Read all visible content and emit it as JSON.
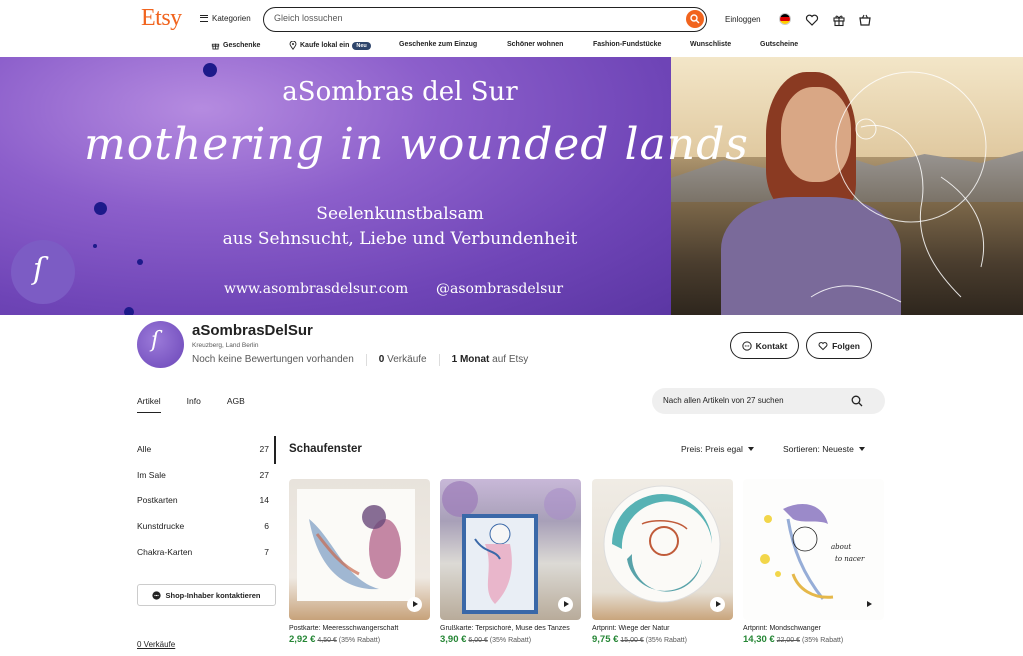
{
  "header": {
    "logo": "Etsy",
    "categories_label": "Kategorien",
    "search_placeholder": "Gleich lossuchen",
    "login_label": "Einloggen"
  },
  "nav": [
    {
      "label": "Geschenke",
      "icon": "gift-icon"
    },
    {
      "label": "Kaufe lokal ein",
      "icon": "location-pin-icon",
      "badge": "Neu"
    },
    {
      "label": "Geschenke zum Einzug"
    },
    {
      "label": "Schöner wohnen"
    },
    {
      "label": "Fashion-Fundstücke"
    },
    {
      "label": "Wunschliste"
    },
    {
      "label": "Gutscheine"
    }
  ],
  "banner": {
    "title": "aSombras del Sur",
    "script": "mothering in wounded lands",
    "line1": "Seelenkunstbalsam",
    "line2": "aus Sehnsucht, Liebe und Verbundenheit",
    "website": "www.asombrasdelsur.com",
    "handle": "@asombrasdelsur"
  },
  "shop": {
    "name": "aSombrasDelSur",
    "location": "Kreuzberg, Land Berlin",
    "reviews": "Noch keine Bewertungen vorhanden",
    "sales_count": "0",
    "sales_label": "Verkäufe",
    "age_value": "1 Monat",
    "age_label": "auf Etsy",
    "contact_label": "Kontakt",
    "follow_label": "Folgen"
  },
  "tabs": [
    "Artikel",
    "Info",
    "AGB"
  ],
  "shop_search_placeholder": "Nach allen Artikeln von 27 suchen",
  "sidebar": {
    "items": [
      {
        "label": "Alle",
        "count": "27"
      },
      {
        "label": "Im Sale",
        "count": "27"
      },
      {
        "label": "Postkarten",
        "count": "14"
      },
      {
        "label": "Kunstdrucke",
        "count": "6"
      },
      {
        "label": "Chakra-Karten",
        "count": "7"
      }
    ],
    "contact_owner_label": "Shop-Inhaber kontaktieren",
    "sales_link": "0 Verkäufe"
  },
  "main": {
    "section_title": "Schaufenster",
    "price_filter": "Preis: Preis egal",
    "sort_filter": "Sortieren: Neueste"
  },
  "listings": [
    {
      "title": "Postkarte: Meeresschwangerschaft",
      "price": "2,92 €",
      "old_price": "4,50 €",
      "discount": "(35% Rabatt)"
    },
    {
      "title": "Grußkarte: Terpsichoré, Muse des Tanzes",
      "price": "3,90 €",
      "old_price": "6,00 €",
      "discount": "(35% Rabatt)"
    },
    {
      "title": "Artprint: Wiege der Natur",
      "price": "9,75 €",
      "old_price": "15,00 €",
      "discount": "(35% Rabatt)"
    },
    {
      "title": "Artprint: Mondschwanger",
      "price": "14,30 €",
      "old_price": "22,00 €",
      "discount": "(35% Rabatt)"
    }
  ],
  "colors": {
    "accent": "#f1641e",
    "price_green": "#258635",
    "badge": "#2f466c"
  }
}
